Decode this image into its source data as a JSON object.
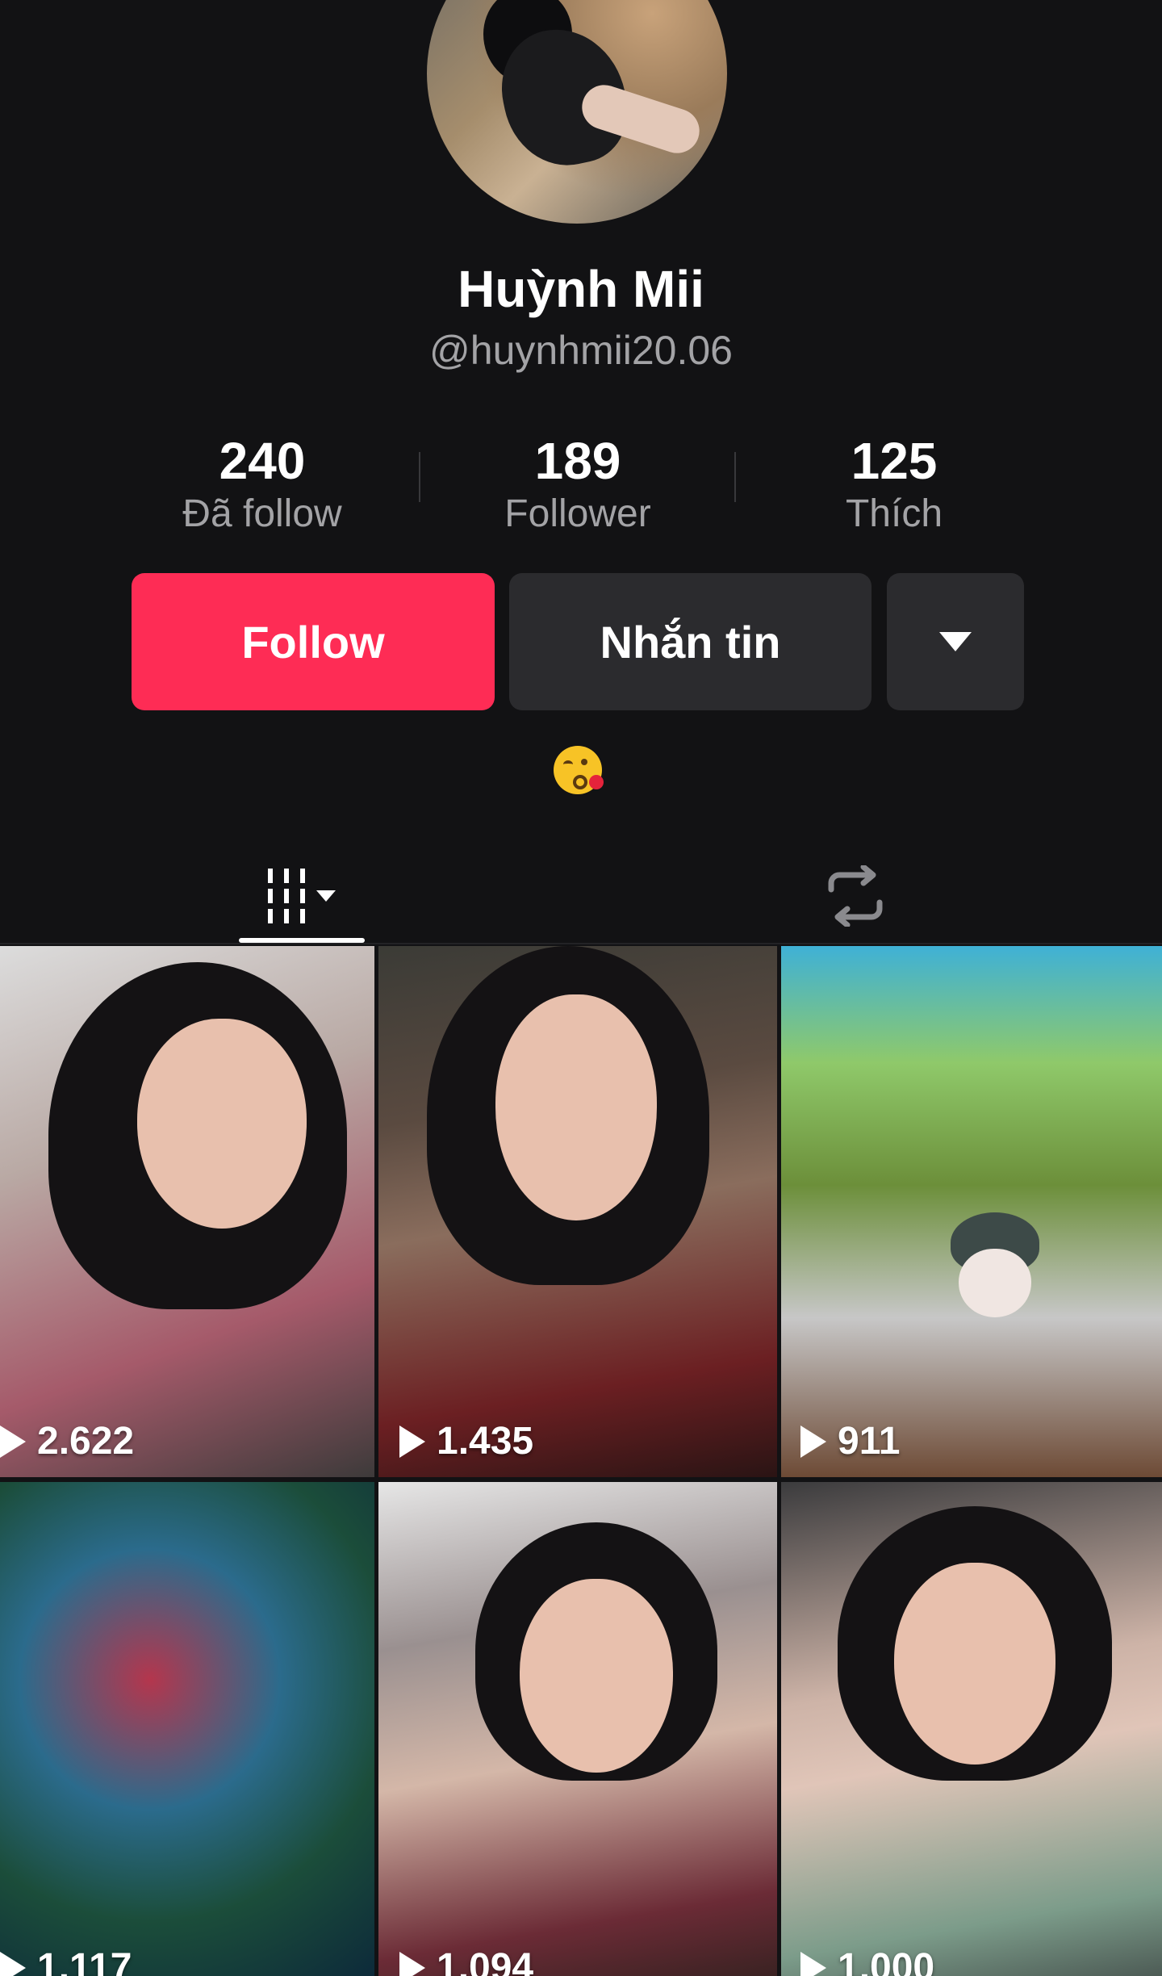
{
  "profile": {
    "name": "Huỳnh Mii",
    "handle": "@huynhmii20.06",
    "bio_emoji": "kissing-face-emoji"
  },
  "stats": [
    {
      "value": "240",
      "label": "Đã follow"
    },
    {
      "value": "189",
      "label": "Follower"
    },
    {
      "value": "125",
      "label": "Thích"
    }
  ],
  "actions": {
    "follow_label": "Follow",
    "message_label": "Nhắn tin",
    "more_icon": "caret-down-icon"
  },
  "colors": {
    "background": "#121214",
    "follow_accent": "#fe2c55",
    "secondary_button": "#2b2b2e",
    "muted_text": "#a3a3a6"
  },
  "tabs": [
    {
      "name": "videos",
      "icon": "grid-icon",
      "selected": true
    },
    {
      "name": "reposts",
      "icon": "repost-icon",
      "selected": false
    }
  ],
  "videos": [
    {
      "views": "2.622"
    },
    {
      "views": "1.435"
    },
    {
      "views": "911"
    },
    {
      "views": "1.117"
    },
    {
      "views": "1.094"
    },
    {
      "views": "1.000"
    }
  ]
}
